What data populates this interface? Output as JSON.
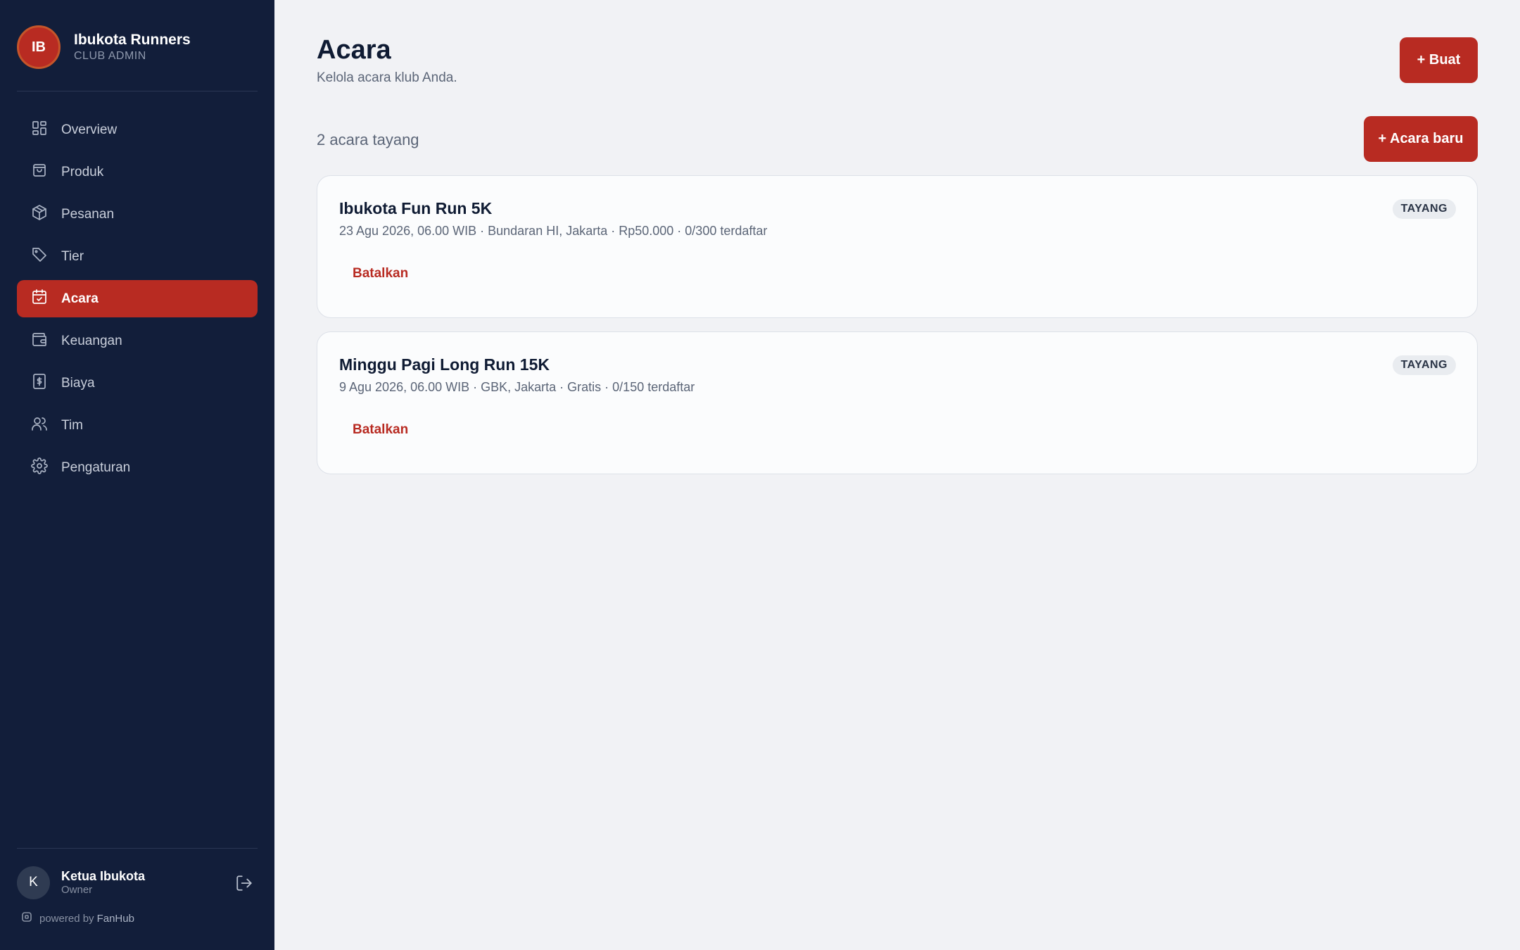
{
  "sidebar": {
    "brand": {
      "initials": "IB",
      "name": "Ibukota Runners",
      "role": "CLUB ADMIN"
    },
    "items": [
      {
        "label": "Overview",
        "icon": "grid-icon"
      },
      {
        "label": "Produk",
        "icon": "shopping-bag-icon"
      },
      {
        "label": "Pesanan",
        "icon": "package-icon"
      },
      {
        "label": "Tier",
        "icon": "tag-icon"
      },
      {
        "label": "Acara",
        "icon": "calendar-check-icon",
        "active": true
      },
      {
        "label": "Keuangan",
        "icon": "wallet-icon"
      },
      {
        "label": "Biaya",
        "icon": "receipt-dollar-icon"
      },
      {
        "label": "Tim",
        "icon": "users-icon"
      },
      {
        "label": "Pengaturan",
        "icon": "gear-icon"
      }
    ],
    "user": {
      "initial": "K",
      "name": "Ketua Ibukota",
      "role": "Owner"
    },
    "powered": {
      "prefix": "powered by",
      "brand": "FanHub"
    }
  },
  "main": {
    "title": "Acara",
    "subtitle": "Kelola acara klub Anda.",
    "create_label": "+ Buat",
    "count_label": "2 acara tayang",
    "new_event_label": "+ Acara baru",
    "events": [
      {
        "title": "Ibukota Fun Run 5K",
        "meta": "23 Agu 2026, 06.00 WIB · Bundaran HI, Jakarta · Rp50.000 · 0/300 terdaftar",
        "status": "TAYANG",
        "cancel_label": "Batalkan"
      },
      {
        "title": "Minggu Pagi Long Run 15K",
        "meta": "9 Agu 2026, 06.00 WIB · GBK, Jakarta · Gratis · 0/150 terdaftar",
        "status": "TAYANG",
        "cancel_label": "Batalkan"
      }
    ]
  },
  "colors": {
    "sidebar_bg": "#121e3a",
    "accent": "#b82b22",
    "page_bg": "#f1f2f5"
  }
}
